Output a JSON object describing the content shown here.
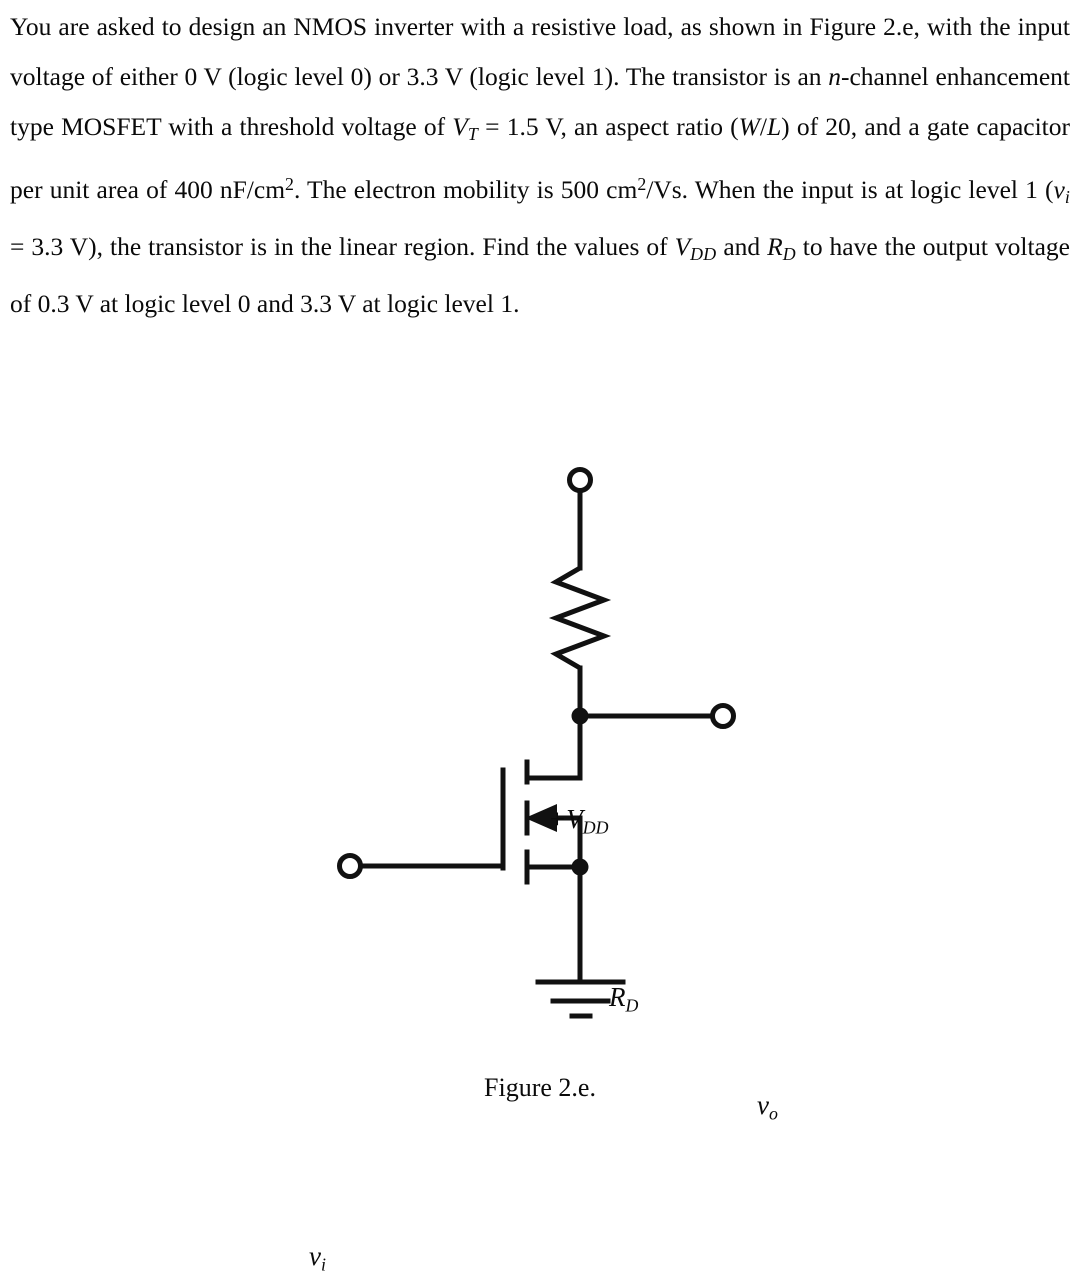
{
  "document": {
    "type": "textbook-problem",
    "problem_statement": {
      "lines": [
        "You are asked to design an NMOS inverter with a resistive load, as shown in Figure",
        "2.e, with the input voltage of either 0 V (logic level 0) or 3.3 V (logic level 1). The",
        "transistor is an n-channel enhancement type MOSFET with a threshold voltage of",
        "VT = 1.5 V, an aspect ratio (W/L) of 20, and a gate capacitor per unit area of",
        "400 nF/cm2. The electron mobility is 500 cm2/Vs. When the input is at logic level 1",
        "(vi = 3.3 V), the transistor is in the linear region. Find the values of VDD and RD to",
        "have the output voltage of 0.3 V at logic level 0 and 3.3 V at logic level 1."
      ],
      "segments": {
        "s1": "You are asked to design an NMOS inverter with a resistive load, as shown in Figure 2.e, with the input voltage of either 0 V (logic level 0) or 3.3 V (logic level 1). The transistor is an ",
        "s2_italic_n": "n",
        "s3": "-channel enhancement type MOSFET with a threshold voltage of ",
        "s4_V": "V",
        "s5_sub_T": "T",
        "s6": " = 1.5 V, an aspect ratio (",
        "s7_italic_W": "W",
        "s8_slash": "/",
        "s9_italic_L": "L",
        "s10": ") of 20, and a gate capacitor per unit area of 400 nF/cm",
        "s11_sup_2": "2",
        "s12": ". The electron mobility is 500 cm",
        "s13_sup_2": "2",
        "s14": "/Vs. When the input is at logic level 1 (",
        "s15_v": "v",
        "s16_sub_i": "i",
        "s17": " = 3.3 V), the transistor is in the linear region. Find the values of ",
        "s18_V": "V",
        "s19_sub_DD": "DD",
        "s20": " and ",
        "s21_R": "R",
        "s22_sub_D": "D",
        "s23": " to have the output voltage of 0.3 V at logic level 0 and 3.3 V at logic level 1."
      },
      "given_values": {
        "threshold_voltage_VT": "1.5 V",
        "aspect_ratio_W_over_L": "20",
        "gate_capacitance_per_area": "400 nF/cm2",
        "electron_mobility": "500 cm2/Vs",
        "input_logic_0": "0 V",
        "input_logic_1": "3.3 V",
        "output_at_logic_0": "0.3 V",
        "output_at_logic_1": "3.3 V"
      },
      "unknowns": [
        "VDD",
        "RD"
      ]
    }
  },
  "figure": {
    "caption": "Figure 2.e.",
    "circuit_type": "NMOS inverter with resistive load",
    "labels": {
      "supply": {
        "prefix": "+",
        "symbol": "V",
        "subscript": "DD"
      },
      "resistor": {
        "symbol": "R",
        "subscript": "D"
      },
      "output": {
        "symbol": "v",
        "subscript": "o"
      },
      "input": {
        "symbol": "v",
        "subscript": "i"
      }
    },
    "components": [
      {
        "name": "supply-terminal",
        "label": "+VDD"
      },
      {
        "name": "load-resistor",
        "label": "RD"
      },
      {
        "name": "output-terminal",
        "label": "vo"
      },
      {
        "name": "input-terminal",
        "label": "vi"
      },
      {
        "name": "nmos-transistor",
        "label": "n-channel enhancement MOSFET"
      },
      {
        "name": "ground-symbol",
        "label": "ground"
      }
    ],
    "colors": {
      "wire": "#111111",
      "background": "#ffffff",
      "text": "#0a0a0a"
    }
  }
}
